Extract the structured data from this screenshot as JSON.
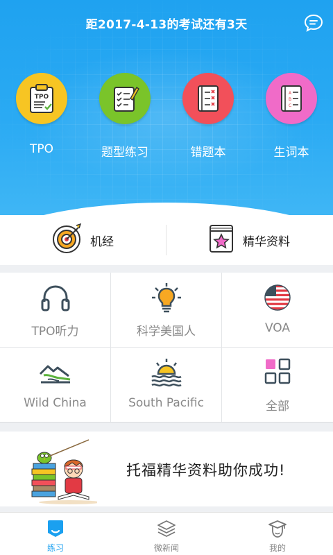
{
  "header": {
    "countdown": "距2017-4-13的考试还有3天",
    "chat_icon": "chat-bubble-icon"
  },
  "top_actions": [
    {
      "label": "TPO",
      "icon": "tpo-clipboard-icon",
      "color": "#f7c523"
    },
    {
      "label": "题型练习",
      "icon": "checklist-pencil-icon",
      "color": "#7ac42a"
    },
    {
      "label": "错题本",
      "icon": "wrong-notebook-icon",
      "color": "#f2505a"
    },
    {
      "label": "生词本",
      "icon": "vocab-notebook-icon",
      "color": "#f06bc8"
    }
  ],
  "features": [
    {
      "label": "机经",
      "icon": "target-icon"
    },
    {
      "label": "精华资料",
      "icon": "star-book-icon"
    }
  ],
  "grid": [
    {
      "label": "TPO听力",
      "icon": "headphones-icon"
    },
    {
      "label": "科学美国人",
      "icon": "lightbulb-icon"
    },
    {
      "label": "VOA",
      "icon": "us-flag-icon"
    },
    {
      "label": "Wild China",
      "icon": "mountain-icon"
    },
    {
      "label": "South Pacific",
      "icon": "sunset-waves-icon"
    },
    {
      "label": "全部",
      "icon": "all-grid-icon"
    }
  ],
  "banner": {
    "text": "托福精华资料助你成功!",
    "image": "student-reading-books-illustration"
  },
  "bottom_nav": [
    {
      "label": "练习",
      "icon": "practice-icon",
      "active": true
    },
    {
      "label": "微新闻",
      "icon": "layers-icon",
      "active": false
    },
    {
      "label": "我的",
      "icon": "profile-graduate-icon",
      "active": false
    }
  ],
  "colors": {
    "primary": "#1fa2f0",
    "yellow": "#f7c523",
    "green": "#7ac42a",
    "red": "#f2505a",
    "pink": "#f06bc8",
    "grid_icon": "#3d4f5c",
    "grid_text": "#888888"
  }
}
